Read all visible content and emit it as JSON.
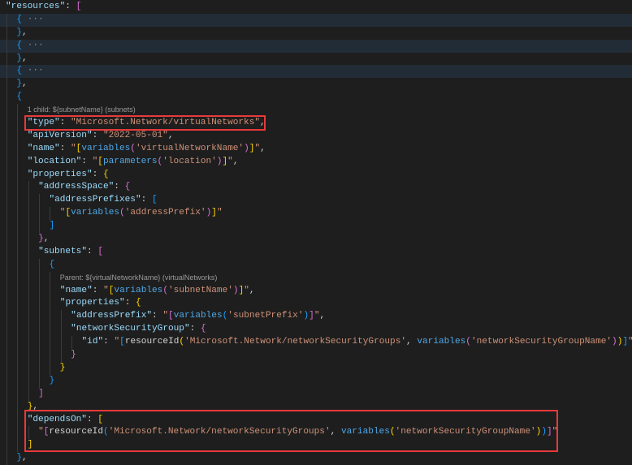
{
  "code_lens": {
    "child": "1 child: ${subnetName} (subnets)",
    "parent": "Parent: ${virtualNetworkName} (virtualNetworks)"
  },
  "lines": [
    [
      [
        "k",
        "\"resources\""
      ],
      [
        "p",
        ": "
      ],
      [
        "b2",
        "["
      ]
    ],
    [
      [
        "b3",
        "{"
      ],
      [
        "g",
        " ···"
      ]
    ],
    [
      [
        "b3",
        "}"
      ],
      [
        "p",
        ","
      ]
    ],
    [
      [
        "b3",
        "{"
      ],
      [
        "g",
        " ···"
      ]
    ],
    [
      [
        "b3",
        "}"
      ],
      [
        "p",
        ","
      ]
    ],
    [
      [
        "b3",
        "{"
      ],
      [
        "g",
        " ···"
      ]
    ],
    [
      [
        "b3",
        "}"
      ],
      [
        "p",
        ","
      ]
    ],
    [
      [
        "b3",
        "{"
      ]
    ],
    [
      [
        "lens",
        "code_lens.child"
      ]
    ],
    [
      [
        "k",
        "\"type\""
      ],
      [
        "p",
        ": "
      ],
      [
        "s",
        "\"Microsoft.Network/virtualNetworks\""
      ],
      [
        "p",
        ","
      ]
    ],
    [
      [
        "k",
        "\"apiVersion\""
      ],
      [
        "p",
        ": "
      ],
      [
        "s",
        "\"2022-05-01\""
      ],
      [
        "p",
        ","
      ]
    ],
    [
      [
        "k",
        "\"name\""
      ],
      [
        "p",
        ": "
      ],
      [
        "s",
        "\""
      ],
      [
        "b1",
        "["
      ],
      [
        "f",
        "variables"
      ],
      [
        "b2",
        "("
      ],
      [
        "s",
        "'virtualNetworkName'"
      ],
      [
        "b2",
        ")"
      ],
      [
        "b1",
        "]"
      ],
      [
        "s",
        "\""
      ],
      [
        "p",
        ","
      ]
    ],
    [
      [
        "k",
        "\"location\""
      ],
      [
        "p",
        ": "
      ],
      [
        "s",
        "\""
      ],
      [
        "b1",
        "["
      ],
      [
        "f",
        "parameters"
      ],
      [
        "b2",
        "("
      ],
      [
        "s",
        "'location'"
      ],
      [
        "b2",
        ")"
      ],
      [
        "b1",
        "]"
      ],
      [
        "s",
        "\""
      ],
      [
        "p",
        ","
      ]
    ],
    [
      [
        "k",
        "\"properties\""
      ],
      [
        "p",
        ": "
      ],
      [
        "b1",
        "{"
      ]
    ],
    [
      [
        "k",
        "\"addressSpace\""
      ],
      [
        "p",
        ": "
      ],
      [
        "b2",
        "{"
      ]
    ],
    [
      [
        "k",
        "\"addressPrefixes\""
      ],
      [
        "p",
        ": "
      ],
      [
        "b3",
        "["
      ]
    ],
    [
      [
        "s",
        "\""
      ],
      [
        "b1",
        "["
      ],
      [
        "f",
        "variables"
      ],
      [
        "b2",
        "("
      ],
      [
        "s",
        "'addressPrefix'"
      ],
      [
        "b2",
        ")"
      ],
      [
        "b1",
        "]"
      ],
      [
        "s",
        "\""
      ]
    ],
    [
      [
        "b3",
        "]"
      ]
    ],
    [
      [
        "b2",
        "}"
      ],
      [
        "p",
        ","
      ]
    ],
    [
      [
        "k",
        "\"subnets\""
      ],
      [
        "p",
        ": "
      ],
      [
        "b2",
        "["
      ]
    ],
    [
      [
        "b3",
        "{"
      ]
    ],
    [
      [
        "lens",
        "code_lens.parent"
      ]
    ],
    [
      [
        "k",
        "\"name\""
      ],
      [
        "p",
        ": "
      ],
      [
        "s",
        "\""
      ],
      [
        "b1",
        "["
      ],
      [
        "f",
        "variables"
      ],
      [
        "b2",
        "("
      ],
      [
        "s",
        "'subnetName'"
      ],
      [
        "b2",
        ")"
      ],
      [
        "b1",
        "]"
      ],
      [
        "s",
        "\""
      ],
      [
        "p",
        ","
      ]
    ],
    [
      [
        "k",
        "\"properties\""
      ],
      [
        "p",
        ": "
      ],
      [
        "b1",
        "{"
      ]
    ],
    [
      [
        "k",
        "\"addressPrefix\""
      ],
      [
        "p",
        ": "
      ],
      [
        "s",
        "\""
      ],
      [
        "b2",
        "["
      ],
      [
        "f",
        "variables"
      ],
      [
        "b3",
        "("
      ],
      [
        "s",
        "'subnetPrefix'"
      ],
      [
        "b3",
        ")"
      ],
      [
        "b2",
        "]"
      ],
      [
        "s",
        "\""
      ],
      [
        "p",
        ","
      ]
    ],
    [
      [
        "k",
        "\"networkSecurityGroup\""
      ],
      [
        "p",
        ": "
      ],
      [
        "b2",
        "{"
      ]
    ],
    [
      [
        "k",
        "\"id\""
      ],
      [
        "p",
        ": "
      ],
      [
        "s",
        "\""
      ],
      [
        "b3",
        "["
      ],
      [
        "p",
        "resourceId"
      ],
      [
        "b1",
        "("
      ],
      [
        "s",
        "'Microsoft.Network/networkSecurityGroups'"
      ],
      [
        "p",
        ", "
      ],
      [
        "f",
        "variables"
      ],
      [
        "b2",
        "("
      ],
      [
        "s",
        "'networkSecurityGroupName'"
      ],
      [
        "b2",
        ")"
      ],
      [
        "b1",
        ")"
      ],
      [
        "b3",
        "]"
      ],
      [
        "s",
        "\""
      ]
    ],
    [
      [
        "b2",
        "}"
      ]
    ],
    [
      [
        "b1",
        "}"
      ]
    ],
    [
      [
        "b3",
        "}"
      ]
    ],
    [
      [
        "b2",
        "]"
      ]
    ],
    [
      [
        "b1",
        "}"
      ],
      [
        "p",
        ","
      ]
    ],
    [
      [
        "k",
        "\"dependsOn\""
      ],
      [
        "p",
        ": "
      ],
      [
        "b1",
        "["
      ]
    ],
    [
      [
        "s",
        "\""
      ],
      [
        "b2",
        "["
      ],
      [
        "p",
        "resourceId"
      ],
      [
        "b3",
        "("
      ],
      [
        "s",
        "'Microsoft.Network/networkSecurityGroups'"
      ],
      [
        "p",
        ", "
      ],
      [
        "f",
        "variables"
      ],
      [
        "b1",
        "("
      ],
      [
        "s",
        "'networkSecurityGroupName'"
      ],
      [
        "b1",
        ")"
      ],
      [
        "b3",
        ")"
      ],
      [
        "b2",
        "]"
      ],
      [
        "s",
        "\""
      ]
    ],
    [
      [
        "b1",
        "]"
      ]
    ],
    [
      [
        "b3",
        "}"
      ],
      [
        "p",
        ","
      ]
    ]
  ]
}
